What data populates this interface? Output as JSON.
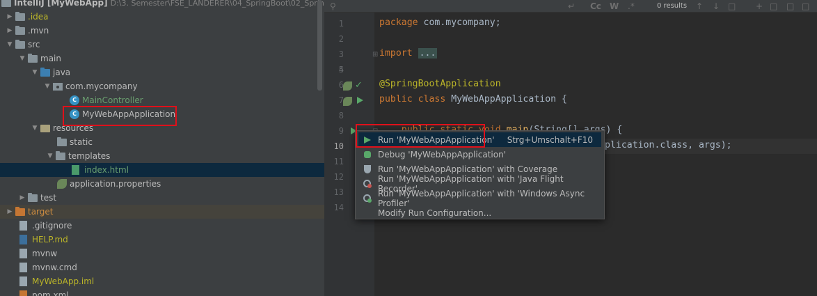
{
  "window": {
    "title": "IntelliJ [MyWebApp]",
    "path": "D:\\3. Semester\\FSE_LANDERER\\04_SpringBoot\\02_SpringBoot"
  },
  "tree": [
    {
      "label": ".idea",
      "color": "yellow"
    },
    {
      "label": ".mvn"
    },
    {
      "label": "src"
    },
    {
      "label": "main"
    },
    {
      "label": "java"
    },
    {
      "label": "com.mycompany"
    },
    {
      "label": "MainController",
      "color": "green"
    },
    {
      "label": "MyWebAppApplication"
    },
    {
      "label": "resources"
    },
    {
      "label": "static"
    },
    {
      "label": "templates"
    },
    {
      "label": "index.html",
      "color": "green"
    },
    {
      "label": "application.properties"
    },
    {
      "label": "test"
    },
    {
      "label": "target",
      "color": "orange"
    },
    {
      "label": ".gitignore"
    },
    {
      "label": "HELP.md",
      "color": "yellow"
    },
    {
      "label": "mvnw"
    },
    {
      "label": "mvnw.cmd"
    },
    {
      "label": "MyWebApp.iml",
      "color": "yellow"
    },
    {
      "label": "pom.xml"
    }
  ],
  "search": {
    "results": "0 results",
    "buttons": [
      "Cc",
      "W",
      ".*"
    ]
  },
  "editor": {
    "lines": [
      "1",
      "2",
      "3",
      "4",
      "5",
      "6",
      "7",
      "8",
      "9",
      "10",
      "11",
      "12",
      "13",
      "14"
    ],
    "code": {
      "l1_kw": "package",
      "l1_rest": " com.mycompany;",
      "l3_kw": "import",
      "l3_dots": "...",
      "l6": "@SpringBootApplication",
      "l7_kw": "public class",
      "l7_rest": " MyWebAppApplication {",
      "l9_a": "    public static void",
      "l9_fn": " main",
      "l9_b": "(String[] args) {",
      "l10": "plication.class, args);"
    }
  },
  "popup": {
    "items": [
      {
        "label": "Run 'MyWebAppApplication'",
        "shortcut": "Strg+Umschalt+F10",
        "icon": "run-icon"
      },
      {
        "label": "Debug 'MyWebAppApplication'",
        "icon": "debug-icon"
      },
      {
        "label": "Run 'MyWebAppApplication' with Coverage",
        "icon": "coverage-icon"
      },
      {
        "label": "Run 'MyWebAppApplication' with 'Java Flight Recorder'",
        "icon": "profiler-icon"
      },
      {
        "label": "Run 'MyWebAppApplication' with 'Windows Async Profiler'",
        "icon": "profiler-icon"
      },
      {
        "label": "Modify Run Configuration..."
      }
    ]
  },
  "colors": {
    "highlight_box": "#e0101a",
    "run_green": "#59a869",
    "selection": "#0d293e"
  }
}
